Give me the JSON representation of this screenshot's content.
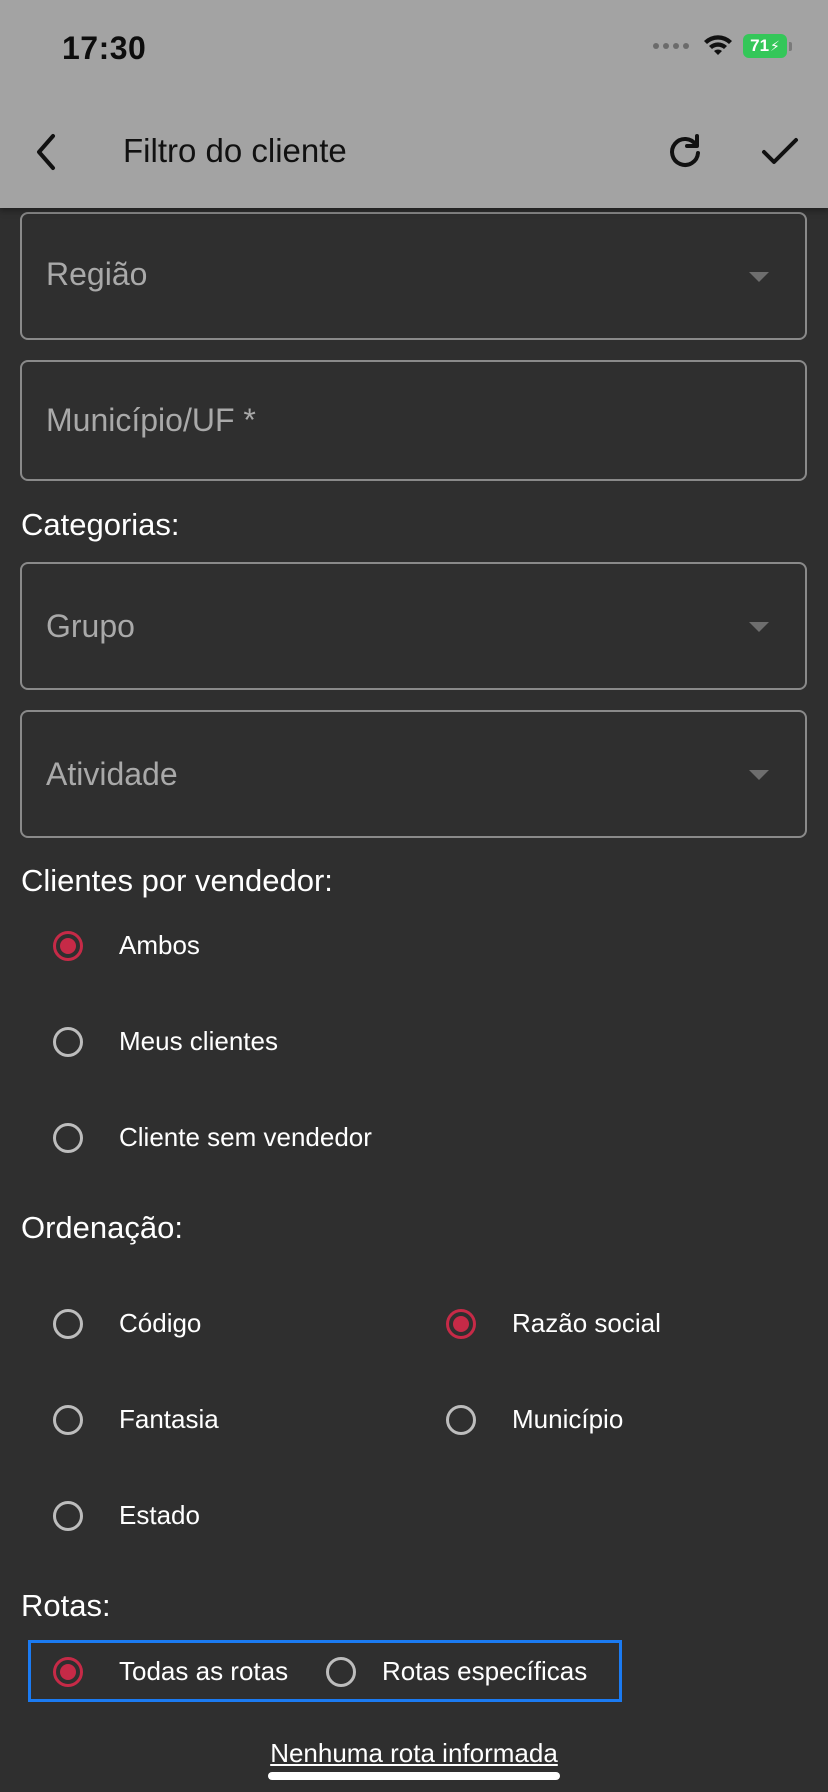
{
  "status_bar": {
    "time": "17:30",
    "battery": "71",
    "battery_color": "#34c759"
  },
  "header": {
    "title": "Filtro do cliente",
    "back_icon": "chevron-left-icon",
    "refresh_icon": "refresh-icon",
    "confirm_icon": "checkmark-icon"
  },
  "fields": {
    "regiao": "Região",
    "municipio_uf": "Município/UF *",
    "grupo": "Grupo",
    "atividade": "Atividade"
  },
  "sections": {
    "categorias": "Categorias:",
    "clientes_por_vendedor": "Clientes por vendedor:",
    "ordenacao": "Ordenação:",
    "rotas": "Rotas:"
  },
  "clientes_options": [
    {
      "label": "Ambos",
      "selected": true
    },
    {
      "label": "Meus clientes",
      "selected": false
    },
    {
      "label": "Cliente sem vendedor",
      "selected": false
    }
  ],
  "ordenacao_options": [
    {
      "label": "Código",
      "selected": false
    },
    {
      "label": "Razão social",
      "selected": true
    },
    {
      "label": "Fantasia",
      "selected": false
    },
    {
      "label": "Município",
      "selected": false
    },
    {
      "label": "Estado",
      "selected": false
    }
  ],
  "rotas_options": [
    {
      "label": "Todas as rotas",
      "selected": true
    },
    {
      "label": "Rotas específicas",
      "selected": false
    }
  ],
  "no_route_link": "Nenhuma rota informada",
  "colors": {
    "accent": "#c62a47",
    "header_bg": "#a3a3a3",
    "background": "#2f2f2f",
    "focus_outline": "#1b7bf2"
  }
}
